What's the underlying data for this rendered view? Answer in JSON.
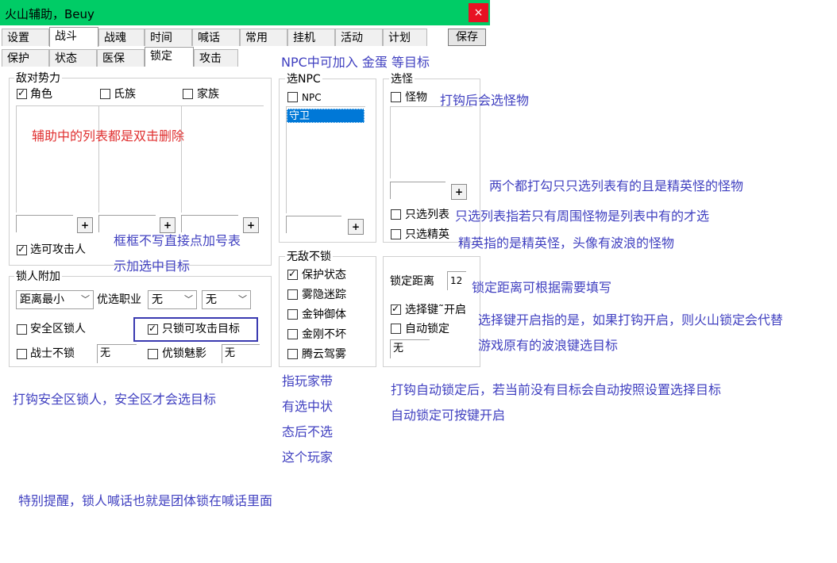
{
  "window": {
    "title": "火山辅助，Beuy",
    "close_glyph": "×"
  },
  "tabs_row1": [
    "设置",
    "战斗",
    "战魂",
    "时间",
    "喊话",
    "常用",
    "挂机",
    "活动",
    "计划"
  ],
  "save_label": "保存",
  "tabs_row2": [
    "保护",
    "状态",
    "医保",
    "锁定",
    "攻击"
  ],
  "enemy": {
    "title": "敌对势力",
    "role": "角色",
    "clan": "氏族",
    "family": "家族",
    "plus": "+",
    "attackable": "选可攻击人"
  },
  "npc": {
    "title": "选NPC",
    "npc_label": "NPC",
    "list_item": "守卫",
    "plus": "+"
  },
  "monster": {
    "title": "选怪",
    "monster_label": "怪物",
    "plus": "+",
    "only_list": "只选列表",
    "only_elite": "只选精英"
  },
  "lock_extra": {
    "title": "锁人附加",
    "distance_select": "距离最小",
    "prefer_job": "优选职业",
    "job1": "无",
    "job2": "无",
    "safe_zone": "安全区锁人",
    "only_attackable": "只锁可攻击目标",
    "warrior_no_lock": "战士不锁",
    "warrior_value": "无",
    "prefer_charm": "优锁魅影",
    "charm_value": "无"
  },
  "invincible": {
    "title": "无敌不锁",
    "items": [
      "保护状态",
      "雾隐迷踪",
      "金钟御体",
      "金刚不坏",
      "腾云驾雾"
    ]
  },
  "lock_settings": {
    "distance_label": "锁定距离",
    "distance_value": "12",
    "select_key": "选择键˜开启",
    "auto_lock": "自动锁定",
    "auto_value": "无"
  },
  "annotations": {
    "npc_gold": "NPC中可加入 金蛋 等目标",
    "double_click": "辅助中的列表都是双击删除",
    "monster_after": "打钩后会选怪物",
    "both_checked": "两个都打勾只只选列表有的且是精英怪的怪物",
    "only_list_desc": "只选列表指若只有周围怪物是列表中有的才选",
    "elite_desc": "精英指的是精英怪，头像有波浪的怪物",
    "empty_plus_1": "框框不写直接点加号表",
    "empty_plus_2": "示加选中目标",
    "distance_desc": "锁定距离可根据需要填写",
    "select_key_1": "选择键开启指的是，如果打钩开启，则火山锁定会代替",
    "select_key_2": "游戏原有的波浪键选目标",
    "player_1": "指玩家带",
    "player_2": "有选中状",
    "player_3": "态后不选",
    "player_4": "这个玩家",
    "safe_zone_desc": "打钩安全区锁人，安全区才会选目标",
    "auto_lock_1": "打钩自动锁定后，若当前没有目标会自动按照设置选择目标",
    "auto_lock_2": "自动锁定可按键开启",
    "reminder": "特别提醒，锁人喊话也就是团体锁在喊话里面"
  }
}
